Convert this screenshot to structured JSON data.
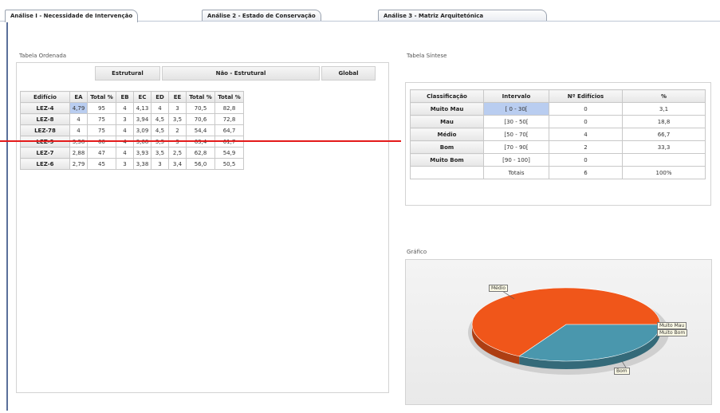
{
  "tabs": [
    {
      "label": "Análise I - Necessidade de Intervenção"
    },
    {
      "label": "Análise 2 - Estado de Conservação"
    },
    {
      "label": "Análise 3 - Matriz Arquitetónica"
    }
  ],
  "left": {
    "section_title": "Tabela Ordenada",
    "groups": {
      "estrutural": "Estrutural",
      "nao_estrutural": "Não - Estrutural",
      "global": "Global"
    },
    "columns": [
      "Edifício",
      "EA",
      "Total %",
      "EB",
      "EC",
      "ED",
      "EE",
      "Total %",
      "Total %"
    ],
    "rows": [
      [
        "LEZ-4",
        "4,79",
        "95",
        "4",
        "4,13",
        "4",
        "3",
        "70,5",
        "82,8"
      ],
      [
        "LEZ-8",
        "4",
        "75",
        "3",
        "3,94",
        "4,5",
        "3,5",
        "70,6",
        "72,8"
      ],
      [
        "LEZ-78",
        "4",
        "75",
        "4",
        "3,09",
        "4,5",
        "2",
        "54,4",
        "64,7"
      ],
      [
        "LEZ-9",
        "3,38",
        "60",
        "4",
        "3,68",
        "3,5",
        "3",
        "63,4",
        "61,7"
      ],
      [
        "LEZ-7",
        "2,88",
        "47",
        "4",
        "3,93",
        "3,5",
        "2,5",
        "62,8",
        "54,9"
      ],
      [
        "LEZ-6",
        "2,79",
        "45",
        "3",
        "3,38",
        "3",
        "3,4",
        "56,0",
        "50,5"
      ]
    ]
  },
  "summary": {
    "section_title": "Tabela Síntese",
    "columns": [
      "Classificação",
      "Intervalo",
      "Nº Edifícios",
      "%"
    ],
    "rows": [
      [
        "Muito Mau",
        "[ 0 - 30[",
        "0",
        "3,1"
      ],
      [
        "Mau",
        "[30 - 50[",
        "0",
        "18,8"
      ],
      [
        "Médio",
        "[50 - 70[",
        "4",
        "66,7"
      ],
      [
        "Bom",
        "[70 - 90[",
        "2",
        "33,3"
      ],
      [
        "Muito Bom",
        "[90 - 100]",
        "0",
        ""
      ]
    ],
    "total_label": "Totais",
    "total_count": "6",
    "total_pct": "100%"
  },
  "chart": {
    "section_title": "Gráfico",
    "labels": {
      "medio": "Médio",
      "muito_mau": "Muito Mau",
      "muito_bom": "Muito Bom",
      "bom": "Bom"
    }
  },
  "colors": {
    "medio": "#f0561a",
    "bom": "#4a97ad",
    "annotation": "#e41a1a",
    "frame": "#5a6f9a"
  },
  "chart_data": {
    "type": "pie",
    "categories": [
      "Médio",
      "Bom",
      "Muito Mau",
      "Muito Bom"
    ],
    "values": [
      66.7,
      33.3,
      0,
      0
    ]
  }
}
